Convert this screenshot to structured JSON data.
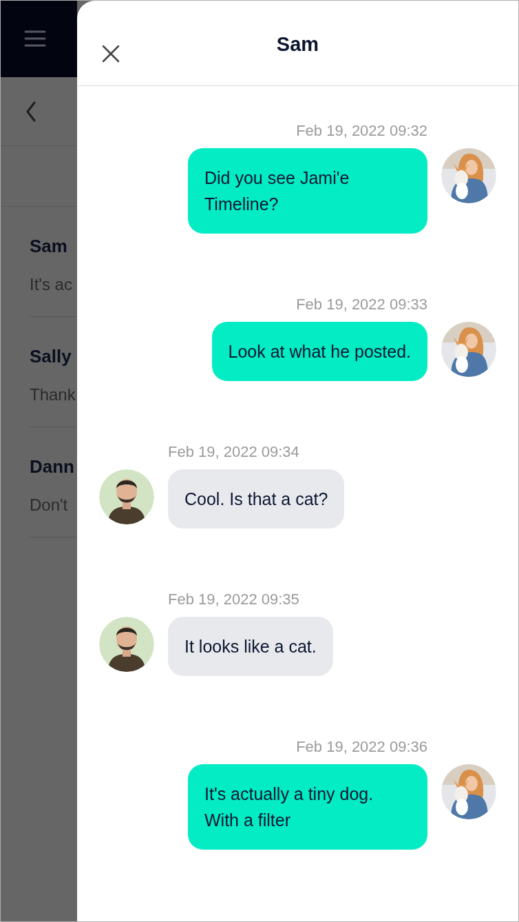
{
  "background_list": {
    "items": [
      {
        "name": "Sam",
        "preview": "It's ac"
      },
      {
        "name": "Sally",
        "preview": "Thank"
      },
      {
        "name": "Dann",
        "preview": "Don't"
      }
    ]
  },
  "drawer": {
    "title": "Sam"
  },
  "messages": [
    {
      "kind": "sent",
      "time": "Feb 19, 2022 09:32",
      "text": "Did you see Jami'e Timeline?"
    },
    {
      "kind": "sent",
      "time": "Feb 19, 2022 09:33",
      "text": "Look at what he posted."
    },
    {
      "kind": "received",
      "time": "Feb 19, 2022 09:34",
      "text": "Cool. Is that a cat?"
    },
    {
      "kind": "received",
      "time": "Feb 19, 2022 09:35",
      "text": "It looks like a cat."
    },
    {
      "kind": "sent",
      "time": "Feb 19, 2022 09:36",
      "text": "It's actually a tiny dog. With a filter"
    }
  ]
}
